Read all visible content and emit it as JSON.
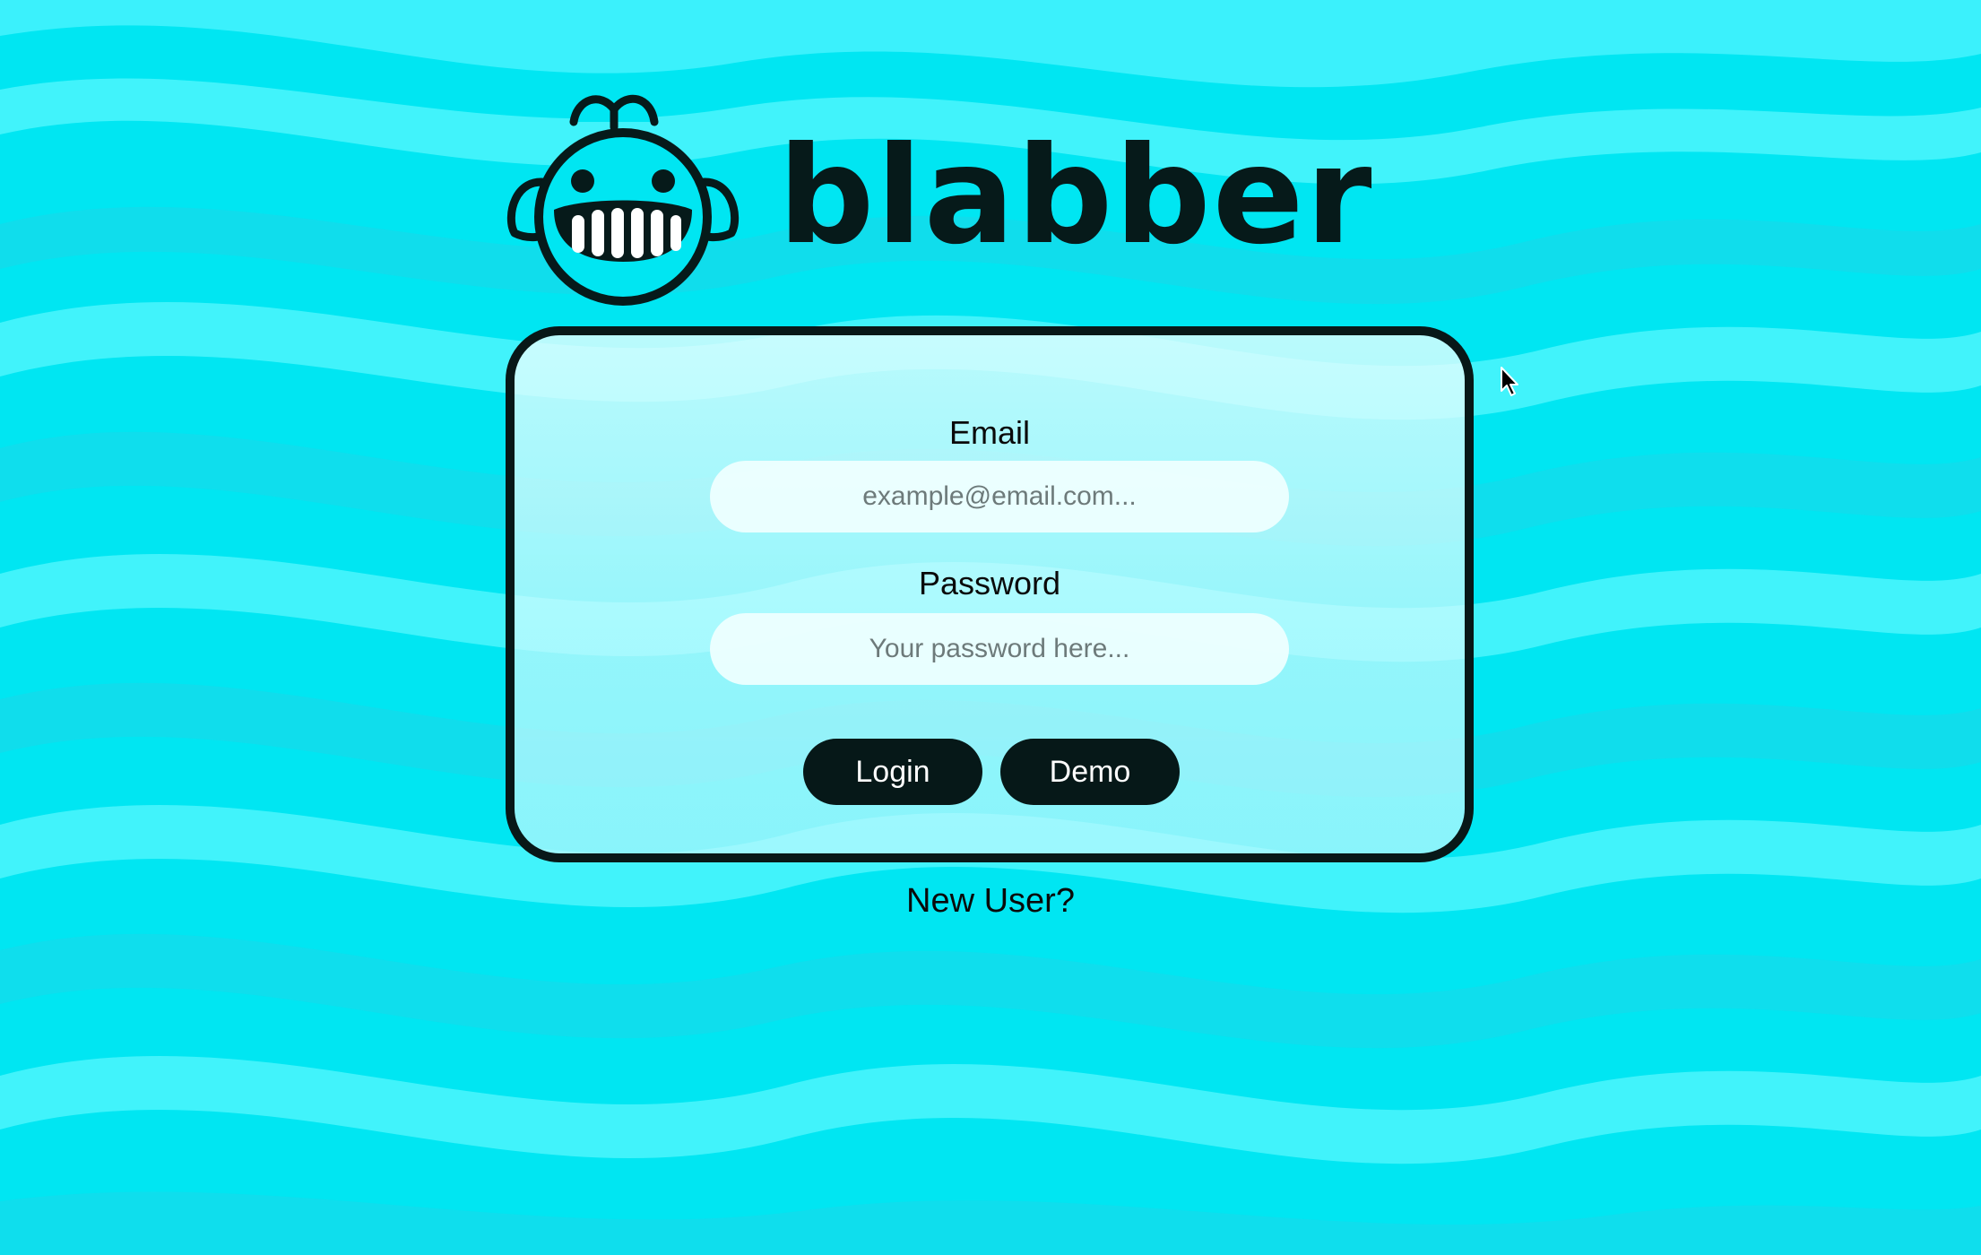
{
  "app": {
    "name": "blabber"
  },
  "login_form": {
    "email_label": "Email",
    "email_placeholder": "example@email.com...",
    "email_value": "",
    "password_label": "Password",
    "password_placeholder": "Your password here...",
    "password_value": "",
    "login_button": "Login",
    "demo_button": "Demo"
  },
  "footer": {
    "new_user_link": "New User?"
  },
  "colors": {
    "background": "#00e8f4",
    "wave_light": "#5cf8ff",
    "wave_dark": "#1fd8e8",
    "brand_dark": "#061a1a",
    "button_bg": "#061818",
    "card_border": "#081818"
  },
  "icons": {
    "logo": "whale-face-icon",
    "cursor": "mouse-pointer-icon"
  }
}
